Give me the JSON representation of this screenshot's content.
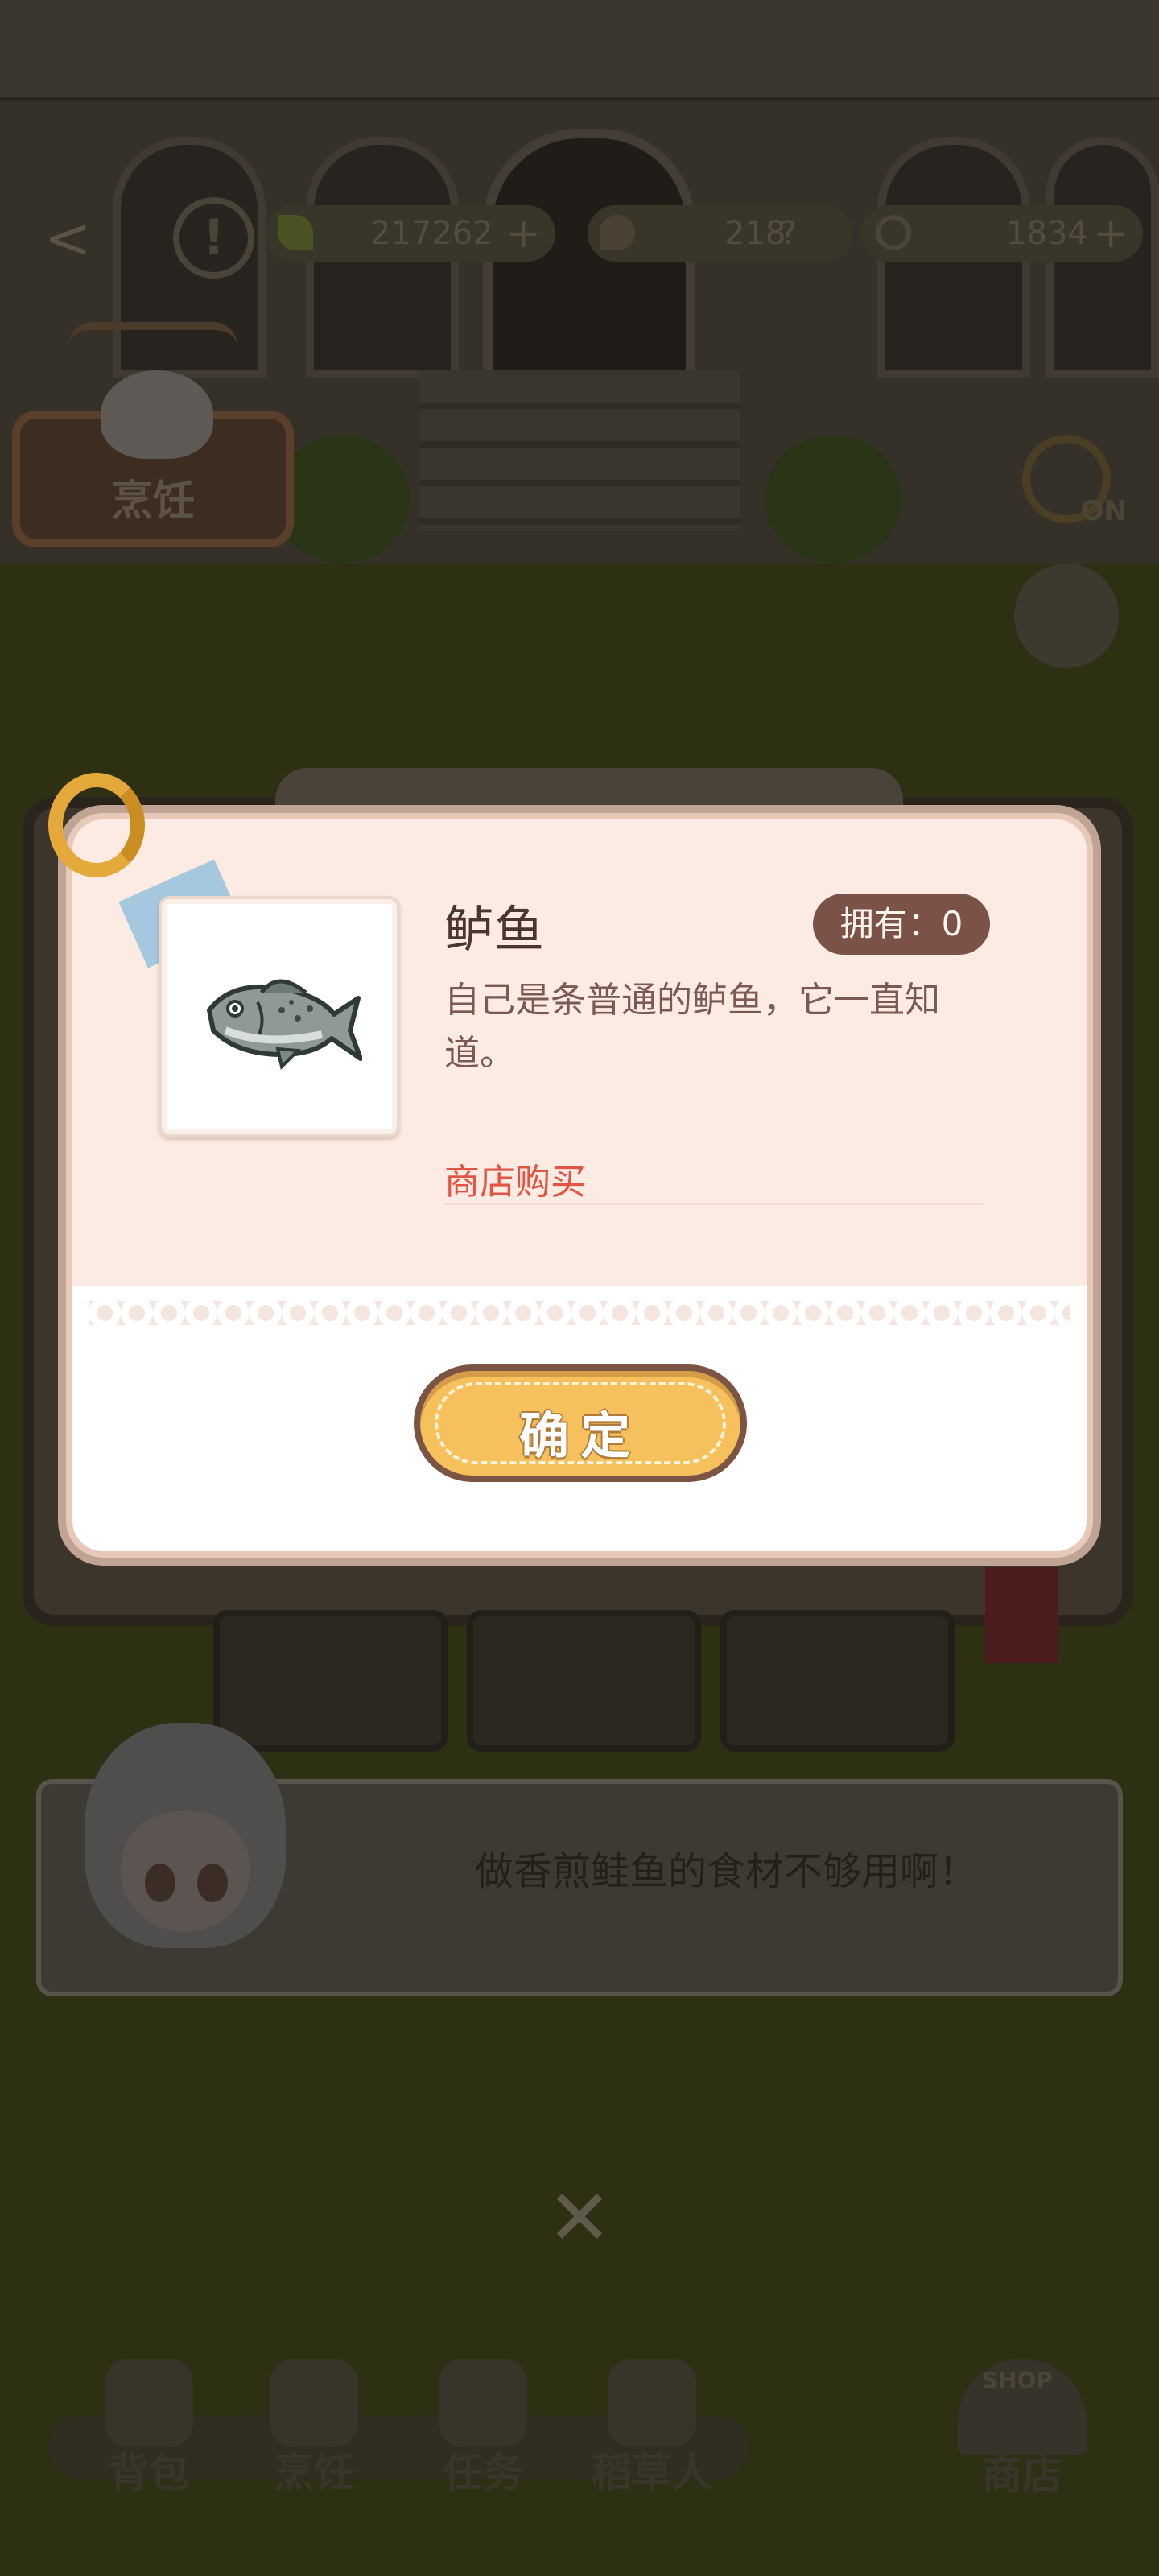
{
  "hud": {
    "currency_1": "217262",
    "currency_2": "218",
    "currency_3": "1834",
    "plus": "+"
  },
  "scene": {
    "cook_sign_label": "烹饪",
    "timer_label": "ON"
  },
  "dialog": {
    "item_name": "鲈鱼",
    "owned_label": "拥有：0",
    "description": "自己是条普通的鲈鱼，它一直知道。",
    "shop_link": "商店购买",
    "confirm_label": "确定"
  },
  "hint": {
    "text": "做香煎鲑鱼的食材不够用啊！"
  },
  "close": "✕",
  "bottom_nav": {
    "items": [
      {
        "label": "背包"
      },
      {
        "label": "烹饪"
      },
      {
        "label": "任务"
      },
      {
        "label": "稻草人"
      }
    ],
    "shop": {
      "label": "商店",
      "tag": "SHOP"
    }
  },
  "colors": {
    "accent_button": "#f6c15d",
    "shop_link": "#e25444",
    "owned_badge": "#7a5247"
  }
}
